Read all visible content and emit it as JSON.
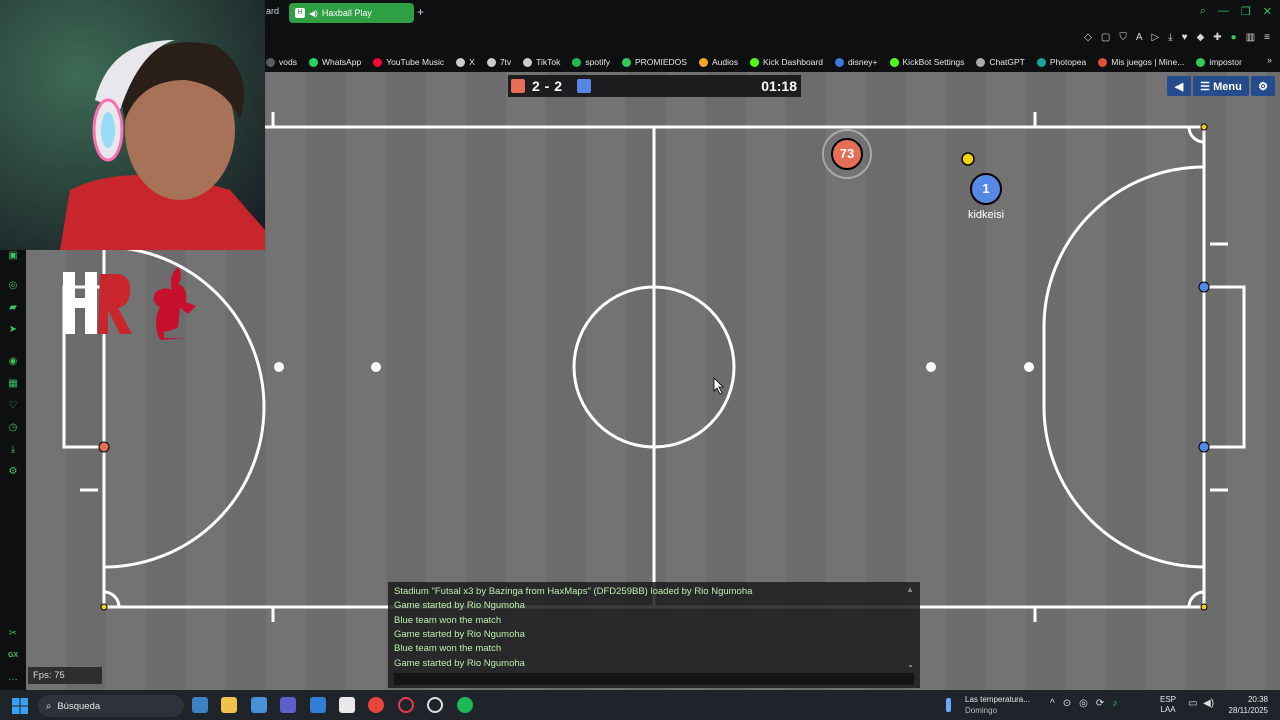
{
  "browser": {
    "partial_tab_label": "ard",
    "active_tab_label": "Haxball Play",
    "new_tab_symbol": "+",
    "bookmarks": [
      {
        "label": "vods",
        "color": "#5a5a5a"
      },
      {
        "label": "WhatsApp",
        "color": "#25d366"
      },
      {
        "label": "YouTube Music",
        "color": "#ff0033"
      },
      {
        "label": "X",
        "color": "#cccccc"
      },
      {
        "label": "7tv",
        "color": "#cccccc"
      },
      {
        "label": "TikTok",
        "color": "#cccccc"
      },
      {
        "label": "spotify",
        "color": "#1db954"
      },
      {
        "label": "PROMIEDOS",
        "color": "#34c759"
      },
      {
        "label": "Audios",
        "color": "#f5a623"
      },
      {
        "label": "Kick Dashboard",
        "color": "#53fc18"
      },
      {
        "label": "disney+",
        "color": "#3a7bd5"
      },
      {
        "label": "KickBot Settings",
        "color": "#53fc18"
      },
      {
        "label": "ChatGPT",
        "color": "#aaaaaa"
      },
      {
        "label": "Photopea",
        "color": "#18a497"
      },
      {
        "label": "Mis juegos | Mine...",
        "color": "#e04e39"
      },
      {
        "label": "impostor",
        "color": "#34c759"
      }
    ],
    "bookmarks_more": "»"
  },
  "game": {
    "score": "2 - 2",
    "timer": "01:18",
    "menu_label": "☰ Menu",
    "sound_icon": "speaker-icon",
    "settings_icon": "gear-icon",
    "red_color": "#e56e56",
    "blue_color": "#5689e5",
    "red_player_number": "73",
    "blue_player_number": "1",
    "blue_player_name": "kidkeisi"
  },
  "chat": {
    "messages": [
      "Stadium \"Futsal x3 by Bazinga from HaxMaps\" (DFD259BB) loaded by Rio Ngumoha",
      "Game started by Rio Ngumoha",
      "Blue team won the match",
      "Game started by Rio Ngumoha",
      "Blue team won the match",
      "Game started by Rio Ngumoha"
    ],
    "input_value": ""
  },
  "fps": "Fps: 75",
  "overlay": {
    "logo_letters": "HR"
  },
  "taskbar": {
    "search_placeholder": "Búsqueda",
    "weather_title": "Las temperatura...",
    "weather_sub": "Domingo",
    "lang_top": "ESP",
    "lang_bottom": "LAA",
    "time": "20:38",
    "date": "28/11/2025"
  }
}
